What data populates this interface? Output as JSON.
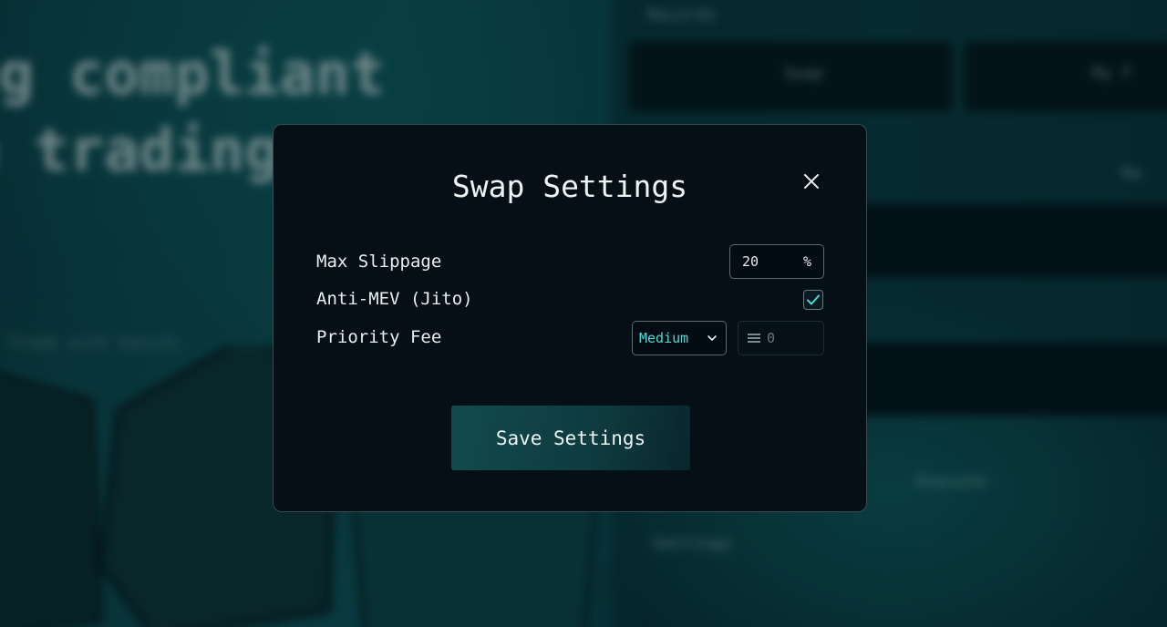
{
  "background": {
    "hero_line_1": "ng compliant",
    "hero_line_2": "e trading",
    "hero_sub": "Trade with Vanish.",
    "tab_records": "Records",
    "tab_swap": "Swap",
    "tab_my": "My F",
    "execute": "Execute",
    "settings": "Settings",
    "right_edge": "Ma"
  },
  "modal": {
    "title": "Swap Settings",
    "close_icon": "close-icon",
    "max_slippage": {
      "label": "Max Slippage",
      "value": "20",
      "unit": "%"
    },
    "anti_mev": {
      "label": "Anti-MEV (Jito)",
      "checked": true
    },
    "priority_fee": {
      "label": "Priority Fee",
      "selected": "Medium",
      "custom_placeholder": "0",
      "custom_icon": "menu-lines-icon"
    },
    "save_label": "Save Settings"
  },
  "colors": {
    "accent": "#4fd8d4",
    "modal_bg": "#040f16",
    "button_bg": "#124b4d"
  }
}
